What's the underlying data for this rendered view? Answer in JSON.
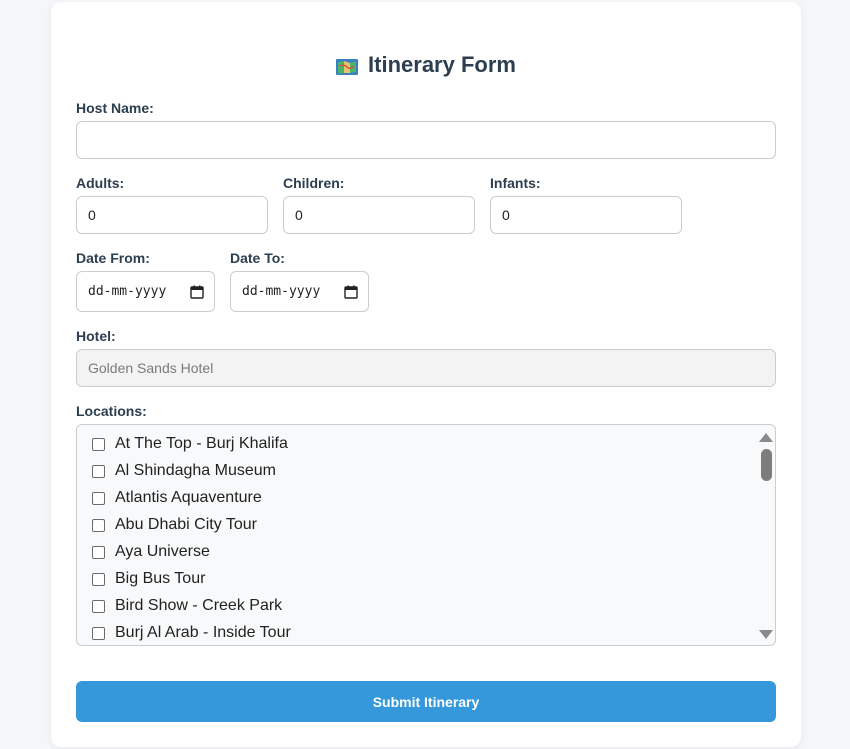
{
  "form": {
    "title": "Itinerary Form",
    "title_icon": "map-icon",
    "host_name": {
      "label": "Host Name:",
      "value": ""
    },
    "adults": {
      "label": "Adults:",
      "value": "0"
    },
    "children": {
      "label": "Children:",
      "value": "0"
    },
    "infants": {
      "label": "Infants:",
      "value": "0"
    },
    "date_from": {
      "label": "Date From:",
      "placeholder": "dd-mm-yyyy"
    },
    "date_to": {
      "label": "Date To:",
      "placeholder": "dd-mm-yyyy"
    },
    "hotel": {
      "label": "Hotel:",
      "value": "Golden Sands Hotel"
    },
    "locations": {
      "label": "Locations:",
      "items": [
        {
          "label": "At The Top - Burj Khalifa",
          "checked": false
        },
        {
          "label": "Al Shindagha Museum",
          "checked": false
        },
        {
          "label": "Atlantis Aquaventure",
          "checked": false
        },
        {
          "label": "Abu Dhabi City Tour",
          "checked": false
        },
        {
          "label": "Aya Universe",
          "checked": false
        },
        {
          "label": "Big Bus Tour",
          "checked": false
        },
        {
          "label": "Bird Show - Creek Park",
          "checked": false
        },
        {
          "label": "Burj Al Arab - Inside Tour",
          "checked": false
        }
      ]
    },
    "submit_label": "Submit Itinerary"
  },
  "colors": {
    "accent": "#3498db",
    "text": "#2c3e50",
    "background": "#f4f6f9"
  }
}
